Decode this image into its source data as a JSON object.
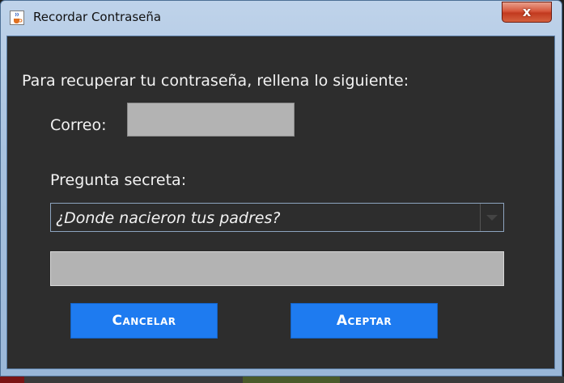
{
  "window": {
    "title": "Recordar Contraseña",
    "close_label": "x"
  },
  "form": {
    "instructions": "Para recuperar tu contraseña, rellena lo siguiente:",
    "correo_label": "Correo:",
    "correo_value": "",
    "question_label": "Pregunta secreta:",
    "question_selected": "¿Donde nacieron tus padres?",
    "answer_value": ""
  },
  "buttons": {
    "cancel_label": "Cancelar",
    "accept_label": "Aceptar"
  },
  "colors": {
    "button_blue": "#1e7bf0",
    "content_bg": "#2d2d2d",
    "input_gray": "#b3b3b3",
    "close_red": "#c23a1f"
  },
  "icons": {
    "app": "java-coffee-cup-icon",
    "close": "close-icon",
    "dropdown": "chevron-down-icon"
  }
}
